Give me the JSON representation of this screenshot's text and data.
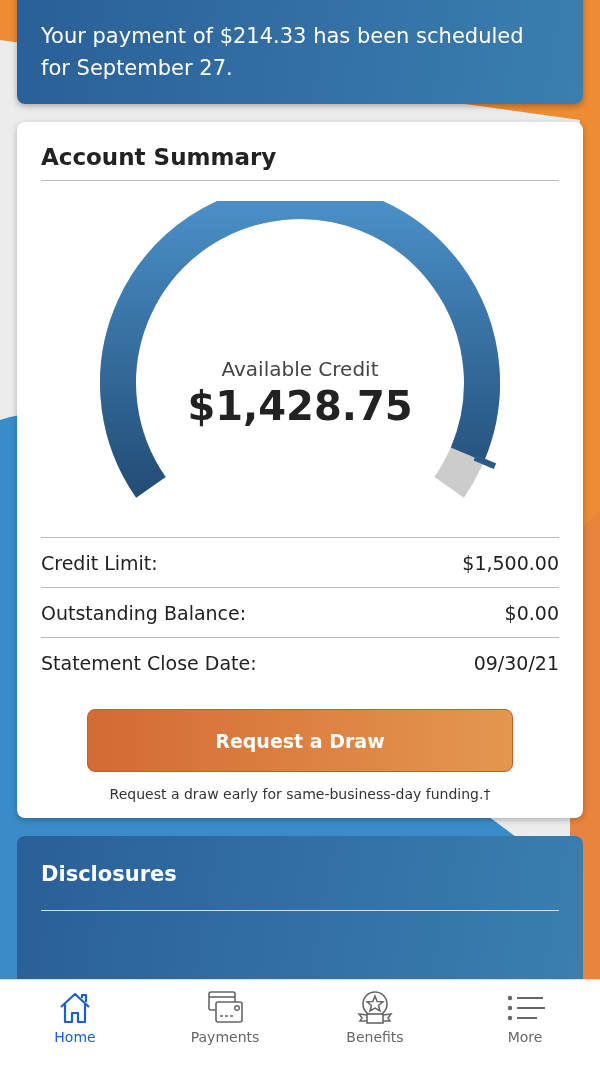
{
  "notice": {
    "message": "Your payment of $214.33 has been scheduled for September 27."
  },
  "account_summary": {
    "title": "Account Summary",
    "gauge": {
      "label": "Available Credit",
      "amount": "$1,428.75"
    },
    "rows": [
      {
        "label": "Credit Limit:",
        "value": "$1,500.00"
      },
      {
        "label": "Outstanding Balance:",
        "value": "$0.00"
      },
      {
        "label": "Statement Close Date:",
        "value": "09/30/21"
      }
    ],
    "button": "Request a Draw",
    "footnote": "Request a draw early for same-business-day funding.†"
  },
  "disclosures": {
    "title": "Disclosures"
  },
  "tab_bar": [
    {
      "kind": "home",
      "label": "Home",
      "selected": true
    },
    {
      "kind": "payments",
      "label": "Payments",
      "selected": false
    },
    {
      "kind": "benefits",
      "label": "Benefits",
      "selected": false
    },
    {
      "kind": "more",
      "label": "More",
      "selected": false
    }
  ]
}
